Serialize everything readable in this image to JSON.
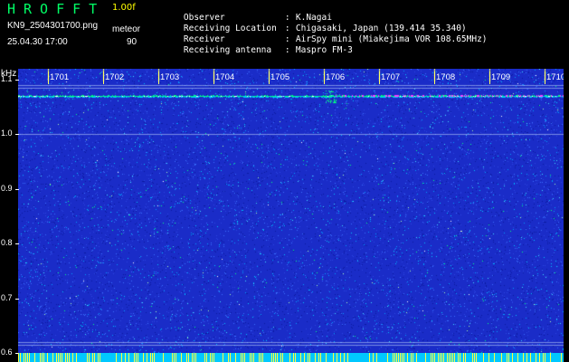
{
  "app": {
    "title": "HROFFT",
    "version": "1.00f",
    "filename": "KN9_2504301700.png",
    "datetime": "25.04.30 17:00",
    "meteor_label": "meteor",
    "meteor_count": "90"
  },
  "info": [
    {
      "label": "Observer",
      "value": "K.Nagai"
    },
    {
      "label": "Receiving Location",
      "value": "Chigasaki, Japan (139.414 35.340)"
    },
    {
      "label": "Receiver",
      "value": "AirSpy mini (Miakejima VOR 108.65MHz)"
    },
    {
      "label": "Receiving antenna",
      "value": "Maspro FM-3"
    }
  ],
  "info_separator": ":",
  "chart_data": {
    "type": "heatmap",
    "ylabel": "kHz",
    "yticks": [
      "1.1",
      "1.0",
      "0.9",
      "0.8",
      "0.7",
      "0.6"
    ],
    "xticks": [
      "1701",
      "1702",
      "1703",
      "1704",
      "1705",
      "1706",
      "1707",
      "1708",
      "1709",
      "1710"
    ],
    "ylim": [
      0.6,
      1.12
    ],
    "carrier_khz": 1.07,
    "colors": {
      "background": "#1a2cc8",
      "noise_light": "#00c8ff",
      "noise_green": "#00ff80",
      "carrier": "#ff40ff",
      "tick_mark": "#ffff66",
      "bottom_strip": "#00c8ff"
    }
  }
}
